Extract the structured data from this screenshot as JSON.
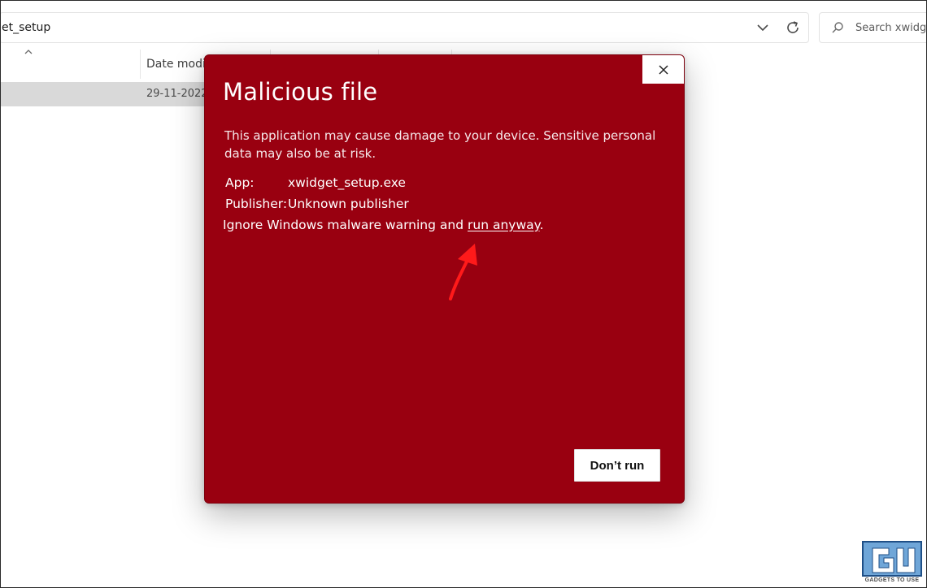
{
  "explorer": {
    "address_path": "et_setup",
    "search_placeholder": "Search xwidget",
    "column_date": "Date modifi",
    "file_row": {
      "date": "29-11-2022"
    }
  },
  "dialog": {
    "title": "Malicious file",
    "description": "This application may cause damage to your device. Sensitive personal data may also be at risk.",
    "app_label": "App:",
    "app_value": "xwidget_setup.exe",
    "publisher_label": "Publisher:",
    "publisher_value": "Unknown publisher",
    "ignore_prefix": "Ignore Windows malware warning and ",
    "run_anyway_link": "run anyway",
    "ignore_suffix": ".",
    "dont_run_button": "Don’t run",
    "colors": {
      "background": "#990010",
      "annotation_arrow": "#ff1a1a"
    }
  },
  "watermark": {
    "text": "GADGETS TO USE"
  }
}
